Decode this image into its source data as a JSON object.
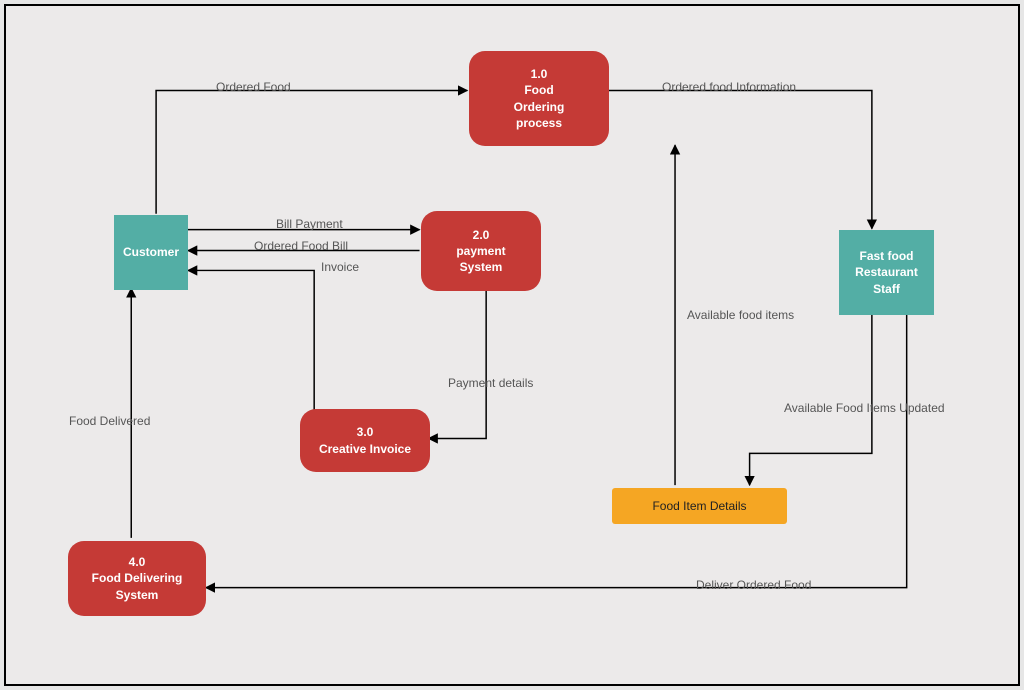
{
  "nodes": {
    "customer": {
      "label": "Customer"
    },
    "process1": {
      "id": "1.0",
      "l1": "Food",
      "l2": "Ordering",
      "l3": "process"
    },
    "process2": {
      "id": "2.0",
      "l1": "payment",
      "l2": "System"
    },
    "process3": {
      "id": "3.0",
      "l1": "Creative Invoice"
    },
    "process4": {
      "id": "4.0",
      "l1": "Food Delivering",
      "l2": "System"
    },
    "staff": {
      "l1": "Fast food",
      "l2": "Restaurant",
      "l3": "Staff"
    },
    "datastore": {
      "label": "Food Item Details"
    }
  },
  "edges": {
    "orderedFood": "Ordered Food",
    "orderedFoodInfo": "Ordered food Information",
    "billPayment": "Bill Payment",
    "orderedFoodBill": "Ordered Food Bill",
    "invoice": "Invoice",
    "paymentDetails": "Payment details",
    "availableFoodItems": "Available food items",
    "availableUpdated": "Available Food Items Updated",
    "foodDelivered": "Food Delivered",
    "deliverOrdered": "Deliver Ordered Food"
  }
}
